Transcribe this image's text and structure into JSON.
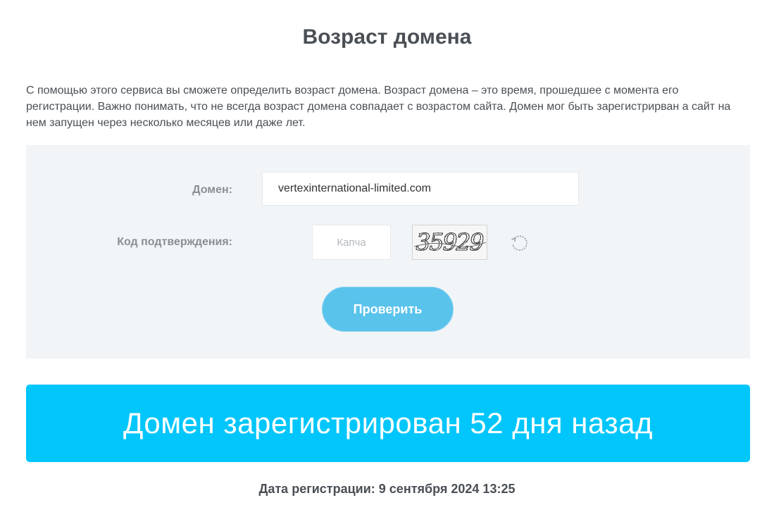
{
  "page": {
    "title": "Возраст домена",
    "intro": "С помощью этого сервиса вы сможете определить возраст домена. Возраст домена – это время, прошедшее с момента его регистрации. Важно понимать, что не всегда возраст домена совпадает с возрастом сайта. Домен мог быть зарегистрирван а сайт на нем запущен через несколько месяцев или даже лет."
  },
  "form": {
    "domain_label": "Домен:",
    "domain_value": "vertexinternational-limited.com",
    "code_label": "Код подтверждения:",
    "captcha_placeholder": "Капча",
    "captcha_text": "35929",
    "refresh_icon": "refresh-icon",
    "submit_label": "Проверить"
  },
  "result": {
    "headline": "Домен зарегистрирован 52 дня назад",
    "registration_date": "Дата регистрации: 9 сентября 2024 13:25"
  },
  "colors": {
    "accent": "#00c6fb",
    "button": "#59c3ec",
    "panel": "#f2f5f7",
    "text": "#4a4f55"
  }
}
